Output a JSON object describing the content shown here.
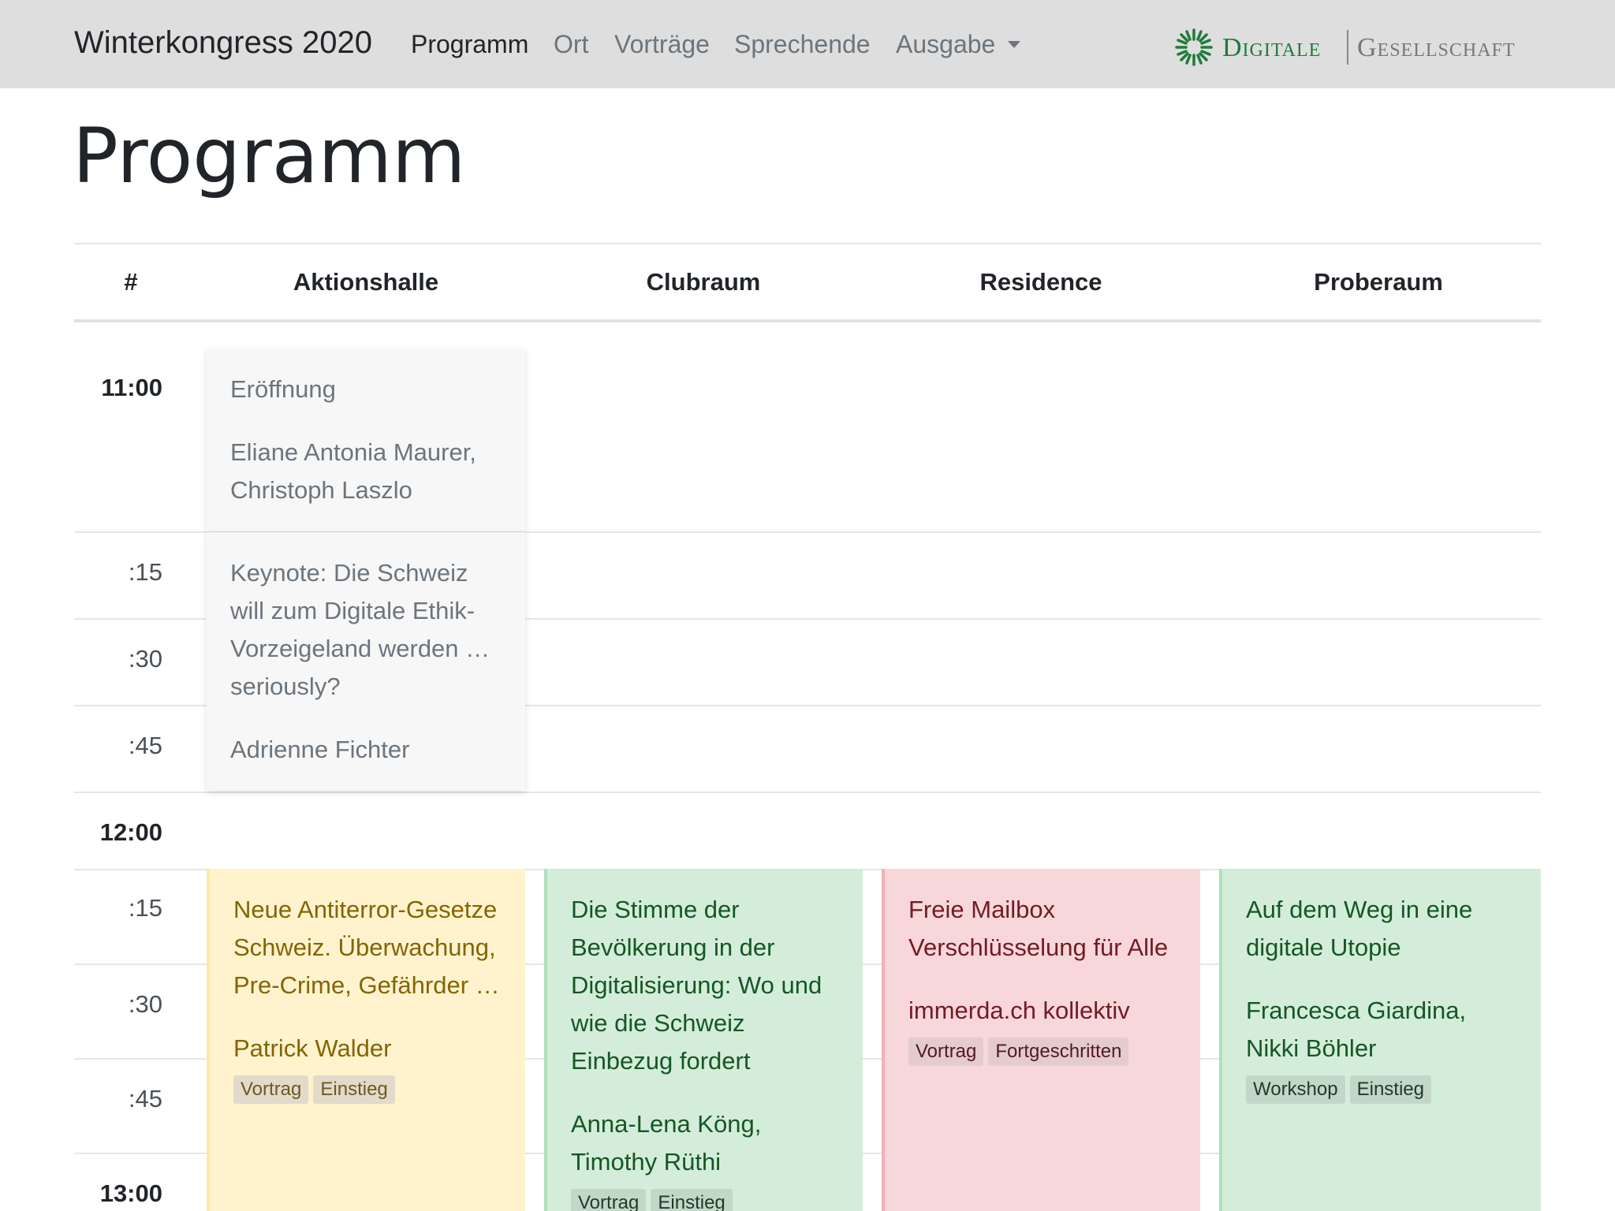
{
  "navbar": {
    "brand": "Winterkongress 2020",
    "items": [
      {
        "label": "Programm",
        "active": true
      },
      {
        "label": "Ort",
        "active": false
      },
      {
        "label": "Vorträge",
        "active": false
      },
      {
        "label": "Sprechende",
        "active": false
      },
      {
        "label": "Ausgabe",
        "active": false,
        "dropdown": true
      }
    ],
    "logo": {
      "word1": "Digitale",
      "word2": "Gesellschaft",
      "icon": "sunburst-logo-icon",
      "color": "#1f7a3a"
    }
  },
  "page": {
    "title": "Programm"
  },
  "table": {
    "columns": [
      "#",
      "Aktionshalle",
      "Clubraum",
      "Residence",
      "Proberaum"
    ],
    "times": [
      "11:00",
      ":15",
      ":30",
      ":45",
      "12:00",
      ":15",
      ":30",
      ":45",
      "13:00"
    ]
  },
  "sessions": [
    {
      "room": "Aktionshalle",
      "title": "Eröffnung",
      "speakers": "Eliane Antonia Maurer, Christoph Laszlo",
      "tags": []
    },
    {
      "room": "Aktionshalle",
      "title": "Keynote: Die Schweiz will zum Digitale Ethik-Vorzeigeland werden … seriously?",
      "speakers": "Adrienne Fichter",
      "tags": []
    },
    {
      "room": "Aktionshalle",
      "title": "Neue Antiterror-Gesetze Schweiz. Überwachung, Pre-Crime, Gefährder …",
      "speakers": "Patrick Walder",
      "tags": [
        "Vortrag",
        "Einstieg"
      ],
      "color": "#fff3cd"
    },
    {
      "room": "Clubraum",
      "title": "Die Stimme der Bevölkerung in der Digitalisierung: Wo und wie die Schweiz Einbezug fordert",
      "speakers": "Anna-Lena Köng, Timothy Rüthi",
      "tags": [
        "Vortrag",
        "Einstieg"
      ],
      "color": "#d4edda"
    },
    {
      "room": "Residence",
      "title": "Freie Mailbox Verschlüsselung für Alle",
      "speakers": "immerda.ch kollektiv",
      "tags": [
        "Vortrag",
        "Fortgeschritten"
      ],
      "color": "#f8d7da"
    },
    {
      "room": "Proberaum",
      "title": "Auf dem Weg in eine digitale Utopie",
      "speakers": "Francesca Giardina, Nikki Böhler",
      "tags": [
        "Workshop",
        "Einstieg"
      ],
      "color": "#d4edda"
    }
  ]
}
